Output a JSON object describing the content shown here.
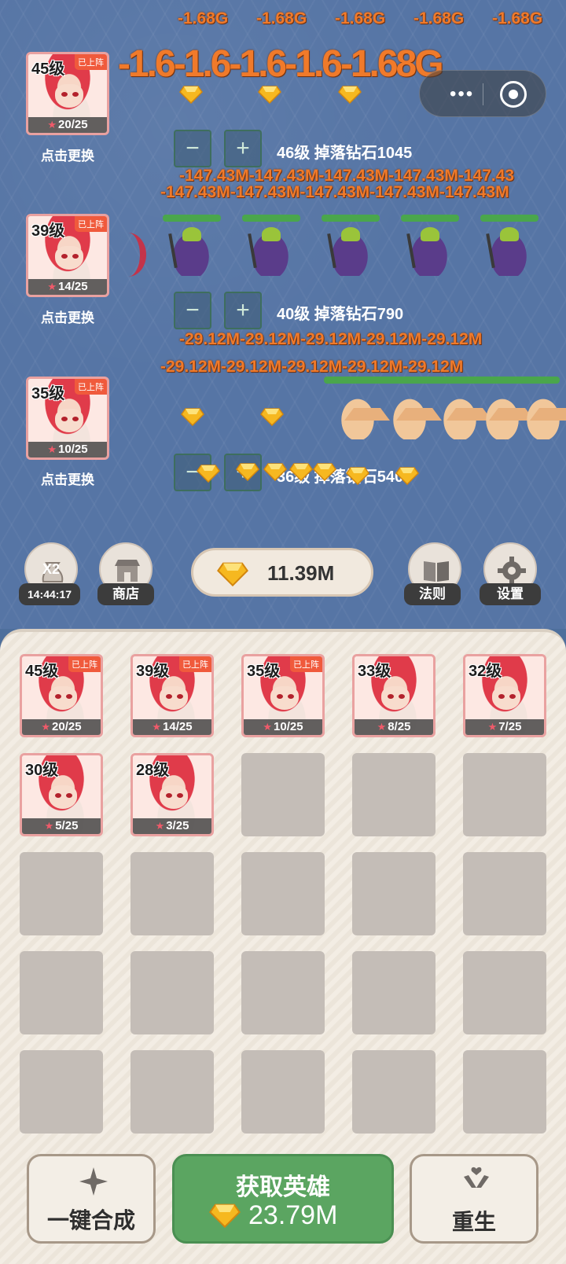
{
  "battle": {
    "damage_top_row": [
      "-1.68G",
      "-1.68G",
      "-1.68G",
      "-1.68G",
      "-1.68G"
    ],
    "damage_big": "-1.6-1.6-1.6-1.6-1.68G",
    "damage_row2_a": "-147.43M-147.43M-147.43M-147.43M-147.43",
    "damage_row2_b": "-147.43M-147.43M-147.43M-147.43M-147.43M",
    "damage_row3_a": "-29.12M-29.12M-29.12M-29.12M-29.12M",
    "damage_row3_b": "-29.12M-29.12M-29.12M-29.12M-29.12M"
  },
  "lanes": [
    {
      "hero_level": "45级",
      "onstage": "已上阵",
      "stars": "20/25",
      "swap": "点击更换",
      "minus": "−",
      "plus": "+",
      "label": "46级 掉落钻石1045"
    },
    {
      "hero_level": "39级",
      "onstage": "已上阵",
      "stars": "14/25",
      "swap": "点击更换",
      "minus": "−",
      "plus": "+",
      "label": "40级 掉落钻石790"
    },
    {
      "hero_level": "35级",
      "onstage": "已上阵",
      "stars": "10/25",
      "swap": "点击更换",
      "minus": "−",
      "plus": "+",
      "label": "36级 掉落钻石540"
    }
  ],
  "toolbar": {
    "x2": "X2",
    "timer": "14:44:17",
    "shop": "商店",
    "gems": "11.39M",
    "rules": "法则",
    "settings": "设置"
  },
  "capsule": {
    "more": "•••"
  },
  "inventory": [
    {
      "level": "45级",
      "onstage": "已上阵",
      "stars": "20/25"
    },
    {
      "level": "39级",
      "onstage": "已上阵",
      "stars": "14/25"
    },
    {
      "level": "35级",
      "onstage": "已上阵",
      "stars": "10/25"
    },
    {
      "level": "33级",
      "onstage": "",
      "stars": "8/25"
    },
    {
      "level": "32级",
      "onstage": "",
      "stars": "7/25"
    },
    {
      "level": "30级",
      "onstage": "",
      "stars": "5/25"
    },
    {
      "level": "28级",
      "onstage": "",
      "stars": "3/25"
    }
  ],
  "buttons": {
    "merge": "一键合成",
    "get_hero": "获取英雄",
    "get_hero_cost": "23.79M",
    "rebirth": "重生"
  },
  "colors": {
    "battle_bg": "#5675a5",
    "damage": "#f07a2a",
    "hp": "#4aa64c",
    "get_button": "#5ba561",
    "onstage_badge": "#f05a3c"
  }
}
